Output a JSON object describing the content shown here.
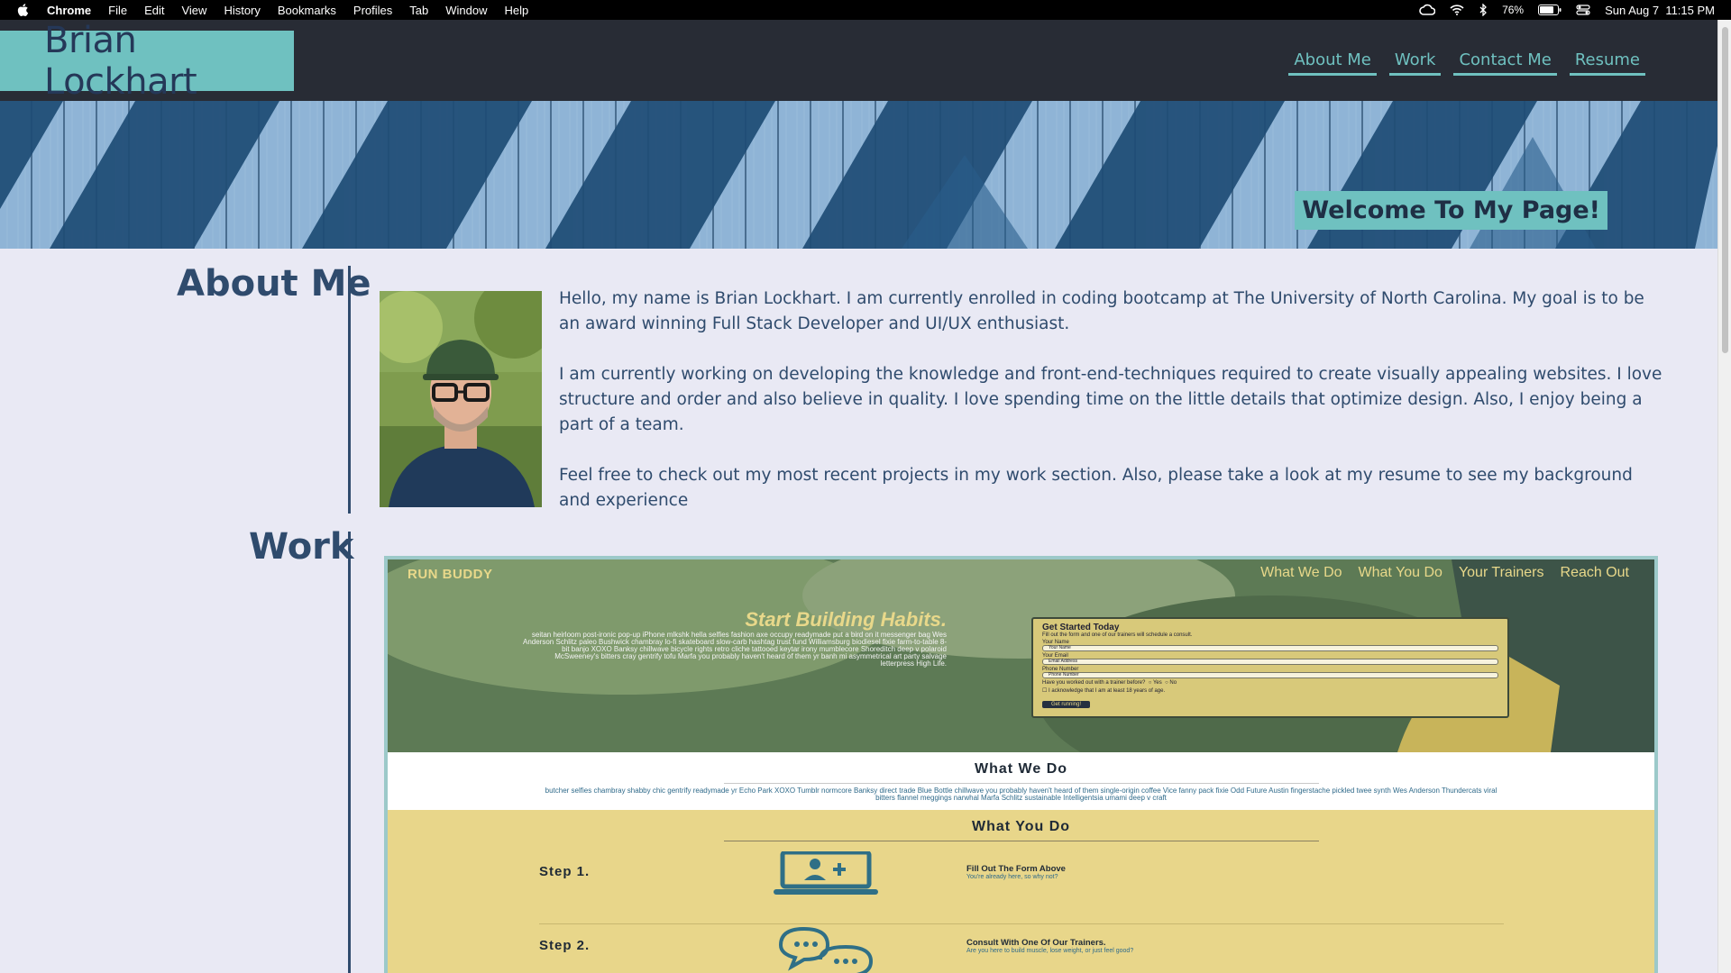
{
  "menubar": {
    "app": "Chrome",
    "items": [
      "File",
      "Edit",
      "View",
      "History",
      "Bookmarks",
      "Profiles",
      "Tab",
      "Window",
      "Help"
    ],
    "battery": "76%",
    "datetime": "Sun Aug 7  11:15 PM"
  },
  "header": {
    "brand": "Brian Lockhart",
    "nav": [
      "About Me",
      "Work",
      "Contact Me",
      "Resume"
    ]
  },
  "hero": {
    "welcome": "Welcome To My Page!"
  },
  "about": {
    "title": "About Me",
    "paragraphs": [
      "Hello, my name is Brian Lockhart. I am currently enrolled in coding bootcamp at The University of North Carolina. My goal is to be an award winning Full Stack Developer and UI/UX enthusiast.",
      "I am currently working on developing the knowledge and front-end-techniques required to create visually appealing websites. I love structure and order and also believe in quality. I love spending time on the little details that optimize design. Also, I enjoy being a part of a team.",
      "Feel free to check out my most recent projects in my work section. Also, please take a look at my resume to see my background and experience"
    ]
  },
  "work": {
    "title": "Work",
    "project": {
      "logo": "RUN BUDDY",
      "nav": [
        "What We Do",
        "What You Do",
        "Your Trainers",
        "Reach Out"
      ],
      "hero_title": "Start Building Habits.",
      "hero_text": "seitan heirloom post-ironic pop-up iPhone mlkshk hella selfies fashion axe occupy readymade put a bird on it messenger bag Wes Anderson Schlitz paleo Bushwick chambray lo-fi skateboard slow-carb hashtag trust fund Williamsburg biodiesel fixie farm-to-table 8-bit banjo XOXO Banksy chillwave bicycle rights retro cliche tattooed keytar irony mumblecore Shoreditch deep v polaroid McSweeney's bitters cray gentrify tofu Marfa you probably haven't heard of them yr banh mi asymmetrical art party salvage letterpress High Life.",
      "form": {
        "title": "Get Started Today",
        "subtitle": "Fill out the form and one of our trainers will schedule a consult.",
        "name_label": "Your Name",
        "name_placeholder": "Your Name",
        "email_label": "Your Email",
        "email_placeholder": "Email Address",
        "phone_label": "Phone Number",
        "phone_placeholder": "Phone Number",
        "question": "Have you worked out with a trainer before?",
        "yes": "Yes",
        "no": "No",
        "ack": "I acknowledge that I am at least 18 years of age.",
        "button": "Get running!"
      },
      "what_we_do": {
        "title": "What We Do",
        "text": "butcher selfies chambray shabby chic gentrify readymade yr Echo Park XOXO Tumblr normcore Banksy direct trade Blue Bottle chillwave you probably haven't heard of them single-origin coffee Vice fanny pack fixie Odd Future Austin fingerstache pickled twee synth Wes Anderson Thundercats viral bitters flannel meggings narwhal Marfa Schlitz sustainable Intelligentsia umami deep v craft"
      },
      "what_you_do": {
        "title": "What You Do",
        "steps": [
          {
            "label": "Step 1.",
            "title": "Fill Out The Form Above",
            "sub": "You're already here, so why not?"
          },
          {
            "label": "Step 2.",
            "title": "Consult With One Of Our Trainers.",
            "sub": "Are you here to build muscle, lose weight, or just feel good?"
          }
        ]
      }
    }
  }
}
